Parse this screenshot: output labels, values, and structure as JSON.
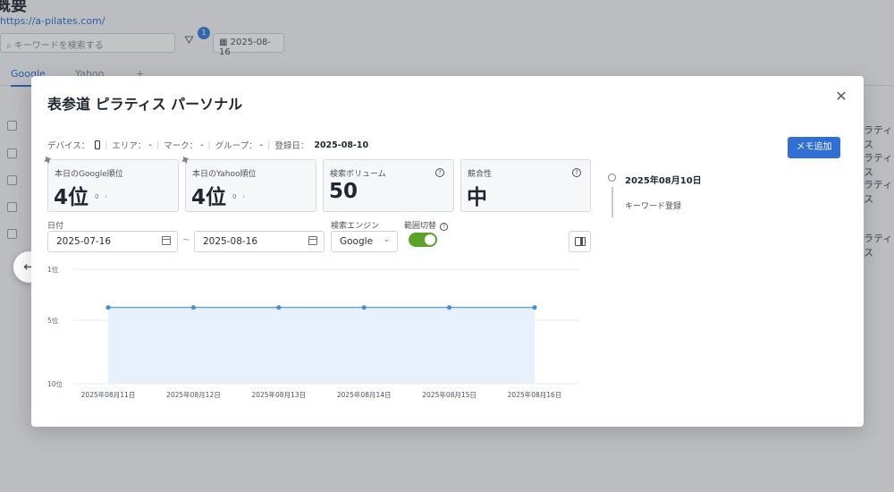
{
  "background": {
    "title": "概要",
    "url": "https://a-pilates.com/",
    "search_placeholder": "キーワードを検索する",
    "filter_badge": "1",
    "date": "2025-08-16",
    "tabs": [
      "Google",
      "Yahoo",
      "+"
    ],
    "right_cells": [
      "ラティス",
      "ラティス",
      "ラティス",
      "ラティス"
    ]
  },
  "modal": {
    "title": "表参道 ピラティス パーソナル",
    "close_icon": "close-icon",
    "meta": {
      "device_label": "デバイス：",
      "area_label": "エリア：",
      "area_value": "-",
      "mark_label": "マーク：",
      "mark_value": "-",
      "group_label": "グループ：",
      "group_value": "-",
      "registered_label": "登録日：",
      "registered_value": "2025-08-10"
    },
    "memo_button": "メモ追加",
    "cards": [
      {
        "label": "本日のGoogle順位",
        "value": "4位",
        "change": "0",
        "pinned": true
      },
      {
        "label": "本日のYahoo順位",
        "value": "4位",
        "change": "0",
        "pinned": true
      },
      {
        "label": "検索ボリューム",
        "value": "50",
        "help": "?"
      },
      {
        "label": "競合性",
        "value": "中",
        "help": "?"
      }
    ],
    "filters": {
      "date_label": "日付",
      "date_from": "2025-07-16",
      "date_to": "2025-08-16",
      "tilde": "~",
      "engine_label": "検索エンジン",
      "engine_value": "Google",
      "range_label": "範囲切替",
      "range_on": true
    },
    "timeline": [
      {
        "date": "2025年08月10日",
        "text": "キーワード登録"
      }
    ]
  },
  "chart_data": {
    "type": "area",
    "x": [
      "2025年08月11日",
      "2025年08月12日",
      "2025年08月13日",
      "2025年08月14日",
      "2025年08月15日",
      "2025年08月16日"
    ],
    "series": [
      {
        "values": [
          4,
          4,
          4,
          4,
          4,
          4
        ]
      }
    ],
    "y_ticks": [
      "1位",
      "5位",
      "10位"
    ],
    "y_tick_values": [
      1,
      5,
      10
    ],
    "ylim": [
      1,
      10
    ],
    "y_inverted": true,
    "grid": true,
    "colors": {
      "line": "#4a8fd9",
      "fill": "#e8f0fb"
    }
  }
}
